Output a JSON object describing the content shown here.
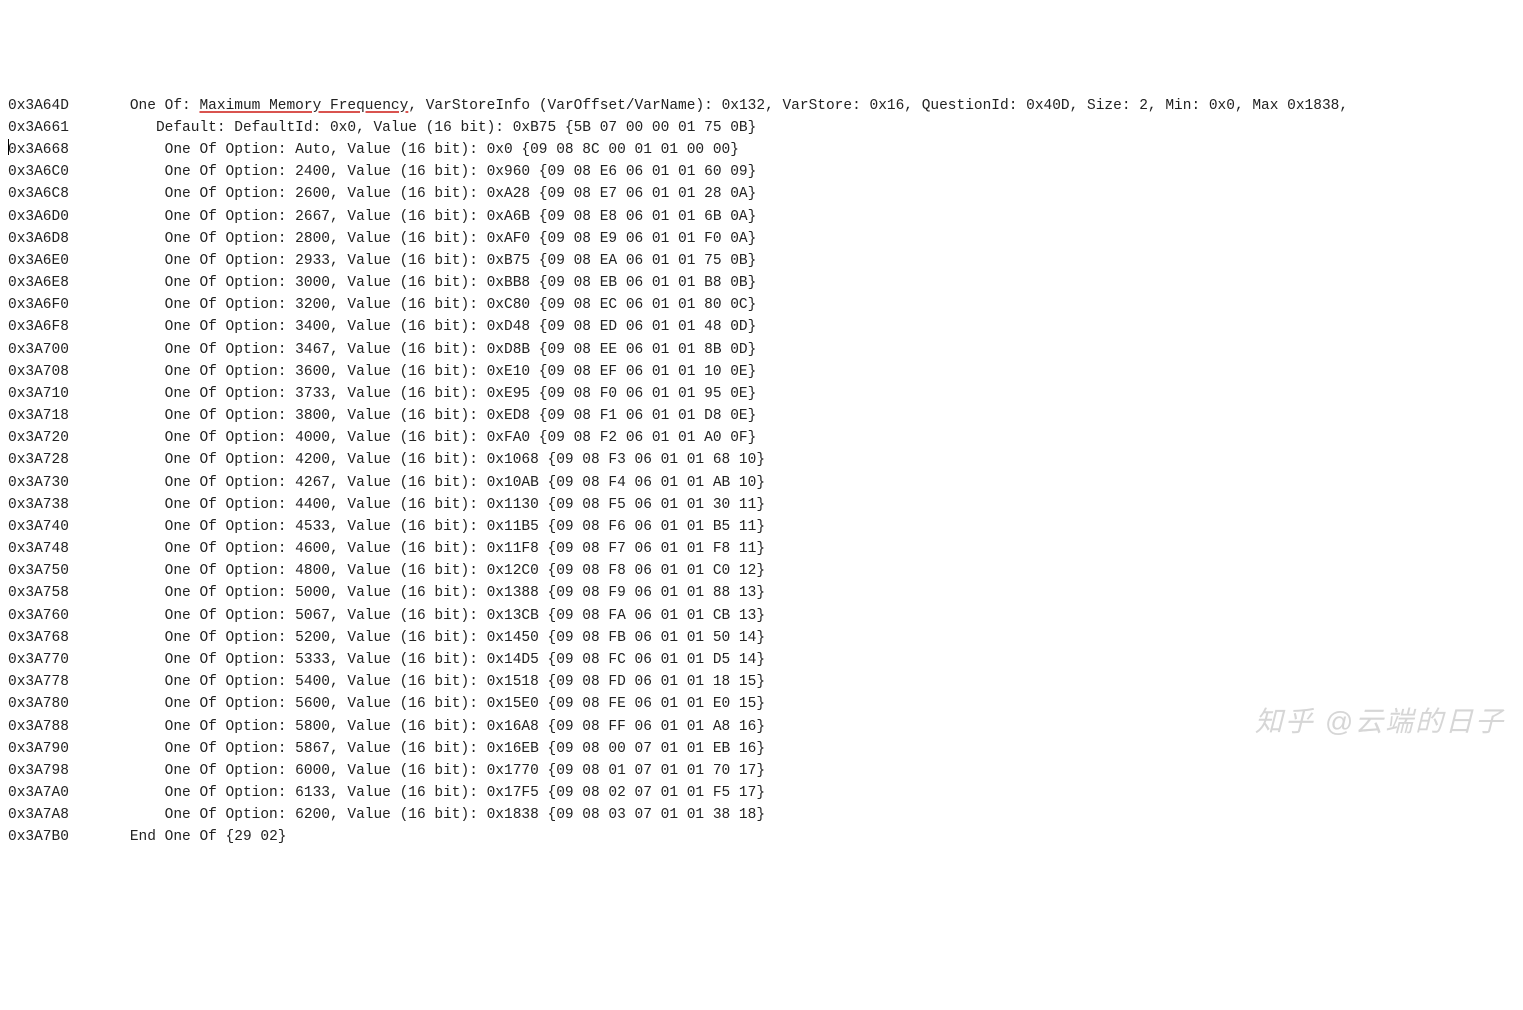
{
  "header": {
    "addr": "0x3A64D",
    "prefix": "One Of: ",
    "title": "Maximum Memory Frequency",
    "rest": ", VarStoreInfo (VarOffset/VarName): 0x132, VarStore: 0x16, QuestionId: 0x40D, Size: 2, Min: 0x0, Max 0x1838,"
  },
  "default_line": {
    "addr": "0x3A661",
    "text": "Default: DefaultId: 0x0, Value (16 bit): 0xB75 {5B 07 00 00 01 75 0B}"
  },
  "options": [
    {
      "addr": "0x3A668",
      "label": "Auto",
      "hex": "0x0",
      "bytes": "{09 08 8C 00 01 01 00 00}"
    },
    {
      "addr": "0x3A6C0",
      "label": "2400",
      "hex": "0x960",
      "bytes": "{09 08 E6 06 01 01 60 09}"
    },
    {
      "addr": "0x3A6C8",
      "label": "2600",
      "hex": "0xA28",
      "bytes": "{09 08 E7 06 01 01 28 0A}"
    },
    {
      "addr": "0x3A6D0",
      "label": "2667",
      "hex": "0xA6B",
      "bytes": "{09 08 E8 06 01 01 6B 0A}"
    },
    {
      "addr": "0x3A6D8",
      "label": "2800",
      "hex": "0xAF0",
      "bytes": "{09 08 E9 06 01 01 F0 0A}"
    },
    {
      "addr": "0x3A6E0",
      "label": "2933",
      "hex": "0xB75",
      "bytes": "{09 08 EA 06 01 01 75 0B}"
    },
    {
      "addr": "0x3A6E8",
      "label": "3000",
      "hex": "0xBB8",
      "bytes": "{09 08 EB 06 01 01 B8 0B}"
    },
    {
      "addr": "0x3A6F0",
      "label": "3200",
      "hex": "0xC80",
      "bytes": "{09 08 EC 06 01 01 80 0C}"
    },
    {
      "addr": "0x3A6F8",
      "label": "3400",
      "hex": "0xD48",
      "bytes": "{09 08 ED 06 01 01 48 0D}"
    },
    {
      "addr": "0x3A700",
      "label": "3467",
      "hex": "0xD8B",
      "bytes": "{09 08 EE 06 01 01 8B 0D}"
    },
    {
      "addr": "0x3A708",
      "label": "3600",
      "hex": "0xE10",
      "bytes": "{09 08 EF 06 01 01 10 0E}"
    },
    {
      "addr": "0x3A710",
      "label": "3733",
      "hex": "0xE95",
      "bytes": "{09 08 F0 06 01 01 95 0E}"
    },
    {
      "addr": "0x3A718",
      "label": "3800",
      "hex": "0xED8",
      "bytes": "{09 08 F1 06 01 01 D8 0E}"
    },
    {
      "addr": "0x3A720",
      "label": "4000",
      "hex": "0xFA0",
      "bytes": "{09 08 F2 06 01 01 A0 0F}"
    },
    {
      "addr": "0x3A728",
      "label": "4200",
      "hex": "0x1068",
      "bytes": "{09 08 F3 06 01 01 68 10}"
    },
    {
      "addr": "0x3A730",
      "label": "4267",
      "hex": "0x10AB",
      "bytes": "{09 08 F4 06 01 01 AB 10}"
    },
    {
      "addr": "0x3A738",
      "label": "4400",
      "hex": "0x1130",
      "bytes": "{09 08 F5 06 01 01 30 11}"
    },
    {
      "addr": "0x3A740",
      "label": "4533",
      "hex": "0x11B5",
      "bytes": "{09 08 F6 06 01 01 B5 11}"
    },
    {
      "addr": "0x3A748",
      "label": "4600",
      "hex": "0x11F8",
      "bytes": "{09 08 F7 06 01 01 F8 11}"
    },
    {
      "addr": "0x3A750",
      "label": "4800",
      "hex": "0x12C0",
      "bytes": "{09 08 F8 06 01 01 C0 12}"
    },
    {
      "addr": "0x3A758",
      "label": "5000",
      "hex": "0x1388",
      "bytes": "{09 08 F9 06 01 01 88 13}"
    },
    {
      "addr": "0x3A760",
      "label": "5067",
      "hex": "0x13CB",
      "bytes": "{09 08 FA 06 01 01 CB 13}"
    },
    {
      "addr": "0x3A768",
      "label": "5200",
      "hex": "0x1450",
      "bytes": "{09 08 FB 06 01 01 50 14}"
    },
    {
      "addr": "0x3A770",
      "label": "5333",
      "hex": "0x14D5",
      "bytes": "{09 08 FC 06 01 01 D5 14}"
    },
    {
      "addr": "0x3A778",
      "label": "5400",
      "hex": "0x1518",
      "bytes": "{09 08 FD 06 01 01 18 15}"
    },
    {
      "addr": "0x3A780",
      "label": "5600",
      "hex": "0x15E0",
      "bytes": "{09 08 FE 06 01 01 E0 15}"
    },
    {
      "addr": "0x3A788",
      "label": "5800",
      "hex": "0x16A8",
      "bytes": "{09 08 FF 06 01 01 A8 16}"
    },
    {
      "addr": "0x3A790",
      "label": "5867",
      "hex": "0x16EB",
      "bytes": "{09 08 00 07 01 01 EB 16}"
    },
    {
      "addr": "0x3A798",
      "label": "6000",
      "hex": "0x1770",
      "bytes": "{09 08 01 07 01 01 70 17}"
    },
    {
      "addr": "0x3A7A0",
      "label": "6133",
      "hex": "0x17F5",
      "bytes": "{09 08 02 07 01 01 F5 17}"
    },
    {
      "addr": "0x3A7A8",
      "label": "6200",
      "hex": "0x1838",
      "bytes": "{09 08 03 07 01 01 38 18}"
    }
  ],
  "footer": {
    "addr": "0x3A7B0",
    "text": "End One Of {29 02}"
  },
  "watermark": "知乎 @云端的日子",
  "indent": {
    "addr_pad": 14,
    "header_pad": 0,
    "default_pad": 3,
    "option_pad": 4,
    "footer_pad": 0
  },
  "option_template": {
    "p1": "One Of Option: ",
    "p2": ", Value (16 bit): ",
    "p3": " "
  }
}
